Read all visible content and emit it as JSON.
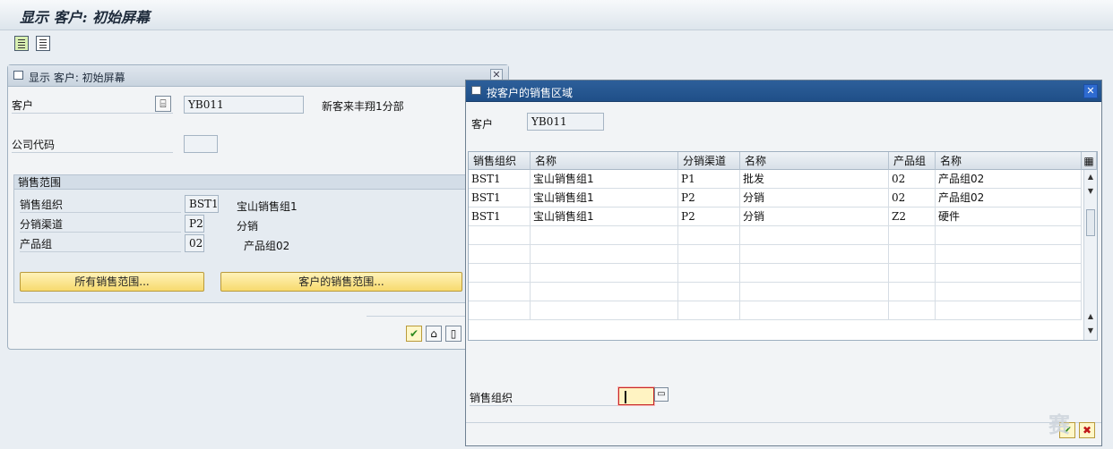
{
  "app": {
    "title": "显示 客户: 初始屏幕"
  },
  "toolbar": {
    "icons": [
      "document-icon",
      "document-alt-icon"
    ]
  },
  "dialog_initial": {
    "title": "显示 客户: 初始屏幕",
    "customer_label": "客户",
    "customer_value": "YB011",
    "customer_name": "新客来丰翔1分部",
    "company_code_label": "公司代码",
    "company_code_value": "",
    "sales_area": {
      "title": "销售范围",
      "rows": [
        {
          "label": "销售组织",
          "value": "BST1",
          "desc": "宝山销售组1"
        },
        {
          "label": "分销渠道",
          "value": "P2",
          "desc": "分销"
        },
        {
          "label": "产品组",
          "value": "02",
          "desc": "产品组02"
        }
      ],
      "buttons": [
        "所有销售范围...",
        "客户的销售范围..."
      ]
    }
  },
  "dialog_sales_area": {
    "title": "按客户的销售区域",
    "customer_label": "客户",
    "customer_value": "YB011",
    "columns": [
      "销售组织",
      "名称",
      "分销渠道",
      "名称",
      "产品组",
      "名称"
    ],
    "rows": [
      [
        "BST1",
        "宝山销售组1",
        "P1",
        "批发",
        "02",
        "产品组02"
      ],
      [
        "BST1",
        "宝山销售组1",
        "P2",
        "分销",
        "02",
        "产品组02"
      ],
      [
        "BST1",
        "宝山销售组1",
        "P2",
        "分销",
        "Z2",
        "硬件"
      ]
    ],
    "filter_label": "销售组织",
    "filter_value": ""
  },
  "watermark": "赛"
}
